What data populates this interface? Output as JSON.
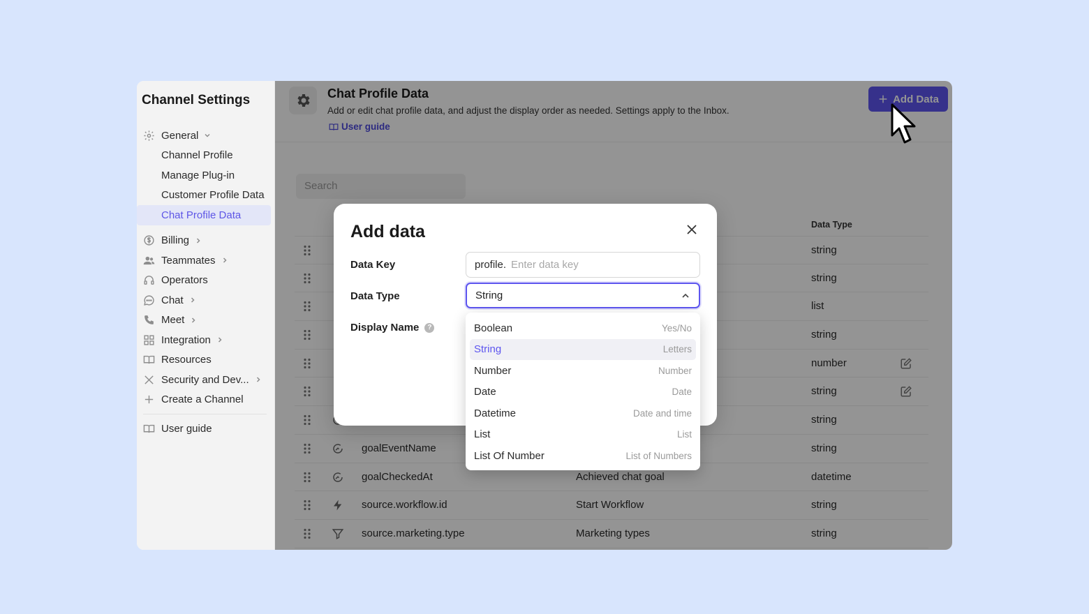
{
  "sidebar": {
    "title": "Channel Settings",
    "general_label": "General",
    "sub_items": [
      "Channel Profile",
      "Manage Plug-in",
      "Customer Profile Data",
      "Chat Profile Data"
    ],
    "items": [
      "Billing",
      "Teammates",
      "Operators",
      "Chat",
      "Meet",
      "Integration",
      "Resources",
      "Security and Dev...",
      "Create a Channel"
    ],
    "user_guide": "User guide"
  },
  "header": {
    "title": "Chat Profile Data",
    "description": "Add or edit chat profile data, and adjust the display order as needed. Settings apply to the Inbox.",
    "guide_link": "User guide",
    "add_button": "Add Data"
  },
  "search": {
    "placeholder": "Search"
  },
  "table": {
    "type_header": "Data Type",
    "rows": [
      {
        "key": "",
        "name": "",
        "type": "string"
      },
      {
        "key": "",
        "name": "",
        "type": "string"
      },
      {
        "key": "",
        "name": "",
        "type": "list"
      },
      {
        "key": "",
        "name": "",
        "type": "string"
      },
      {
        "key": "",
        "name": "",
        "type": "number"
      },
      {
        "key": "",
        "name": "",
        "type": "string"
      },
      {
        "key": "",
        "name": "",
        "type": "string"
      },
      {
        "key": "goalEventName",
        "name": "",
        "type": "string"
      },
      {
        "key": "goalCheckedAt",
        "name": "Achieved chat goal",
        "type": "datetime"
      },
      {
        "key": "source.workflow.id",
        "name": "Start Workflow",
        "type": "string"
      },
      {
        "key": "source.marketing.type",
        "name": "Marketing types",
        "type": "string"
      }
    ]
  },
  "modal": {
    "title": "Add data",
    "data_key_label": "Data Key",
    "data_key_prefix": "profile.",
    "data_key_placeholder": "Enter data key",
    "data_type_label": "Data Type",
    "data_type_value": "String",
    "display_name_label": "Display Name",
    "help_icon": "?"
  },
  "dropdown": {
    "options": [
      {
        "label": "Boolean",
        "hint": "Yes/No"
      },
      {
        "label": "String",
        "hint": "Letters"
      },
      {
        "label": "Number",
        "hint": "Number"
      },
      {
        "label": "Date",
        "hint": "Date"
      },
      {
        "label": "Datetime",
        "hint": "Date and time"
      },
      {
        "label": "List",
        "hint": "List"
      },
      {
        "label": "List Of Number",
        "hint": "List of Numbers"
      }
    ],
    "selected_index": 1
  },
  "colors": {
    "accent": "#5d55ef",
    "background": "#d8e5fd"
  }
}
